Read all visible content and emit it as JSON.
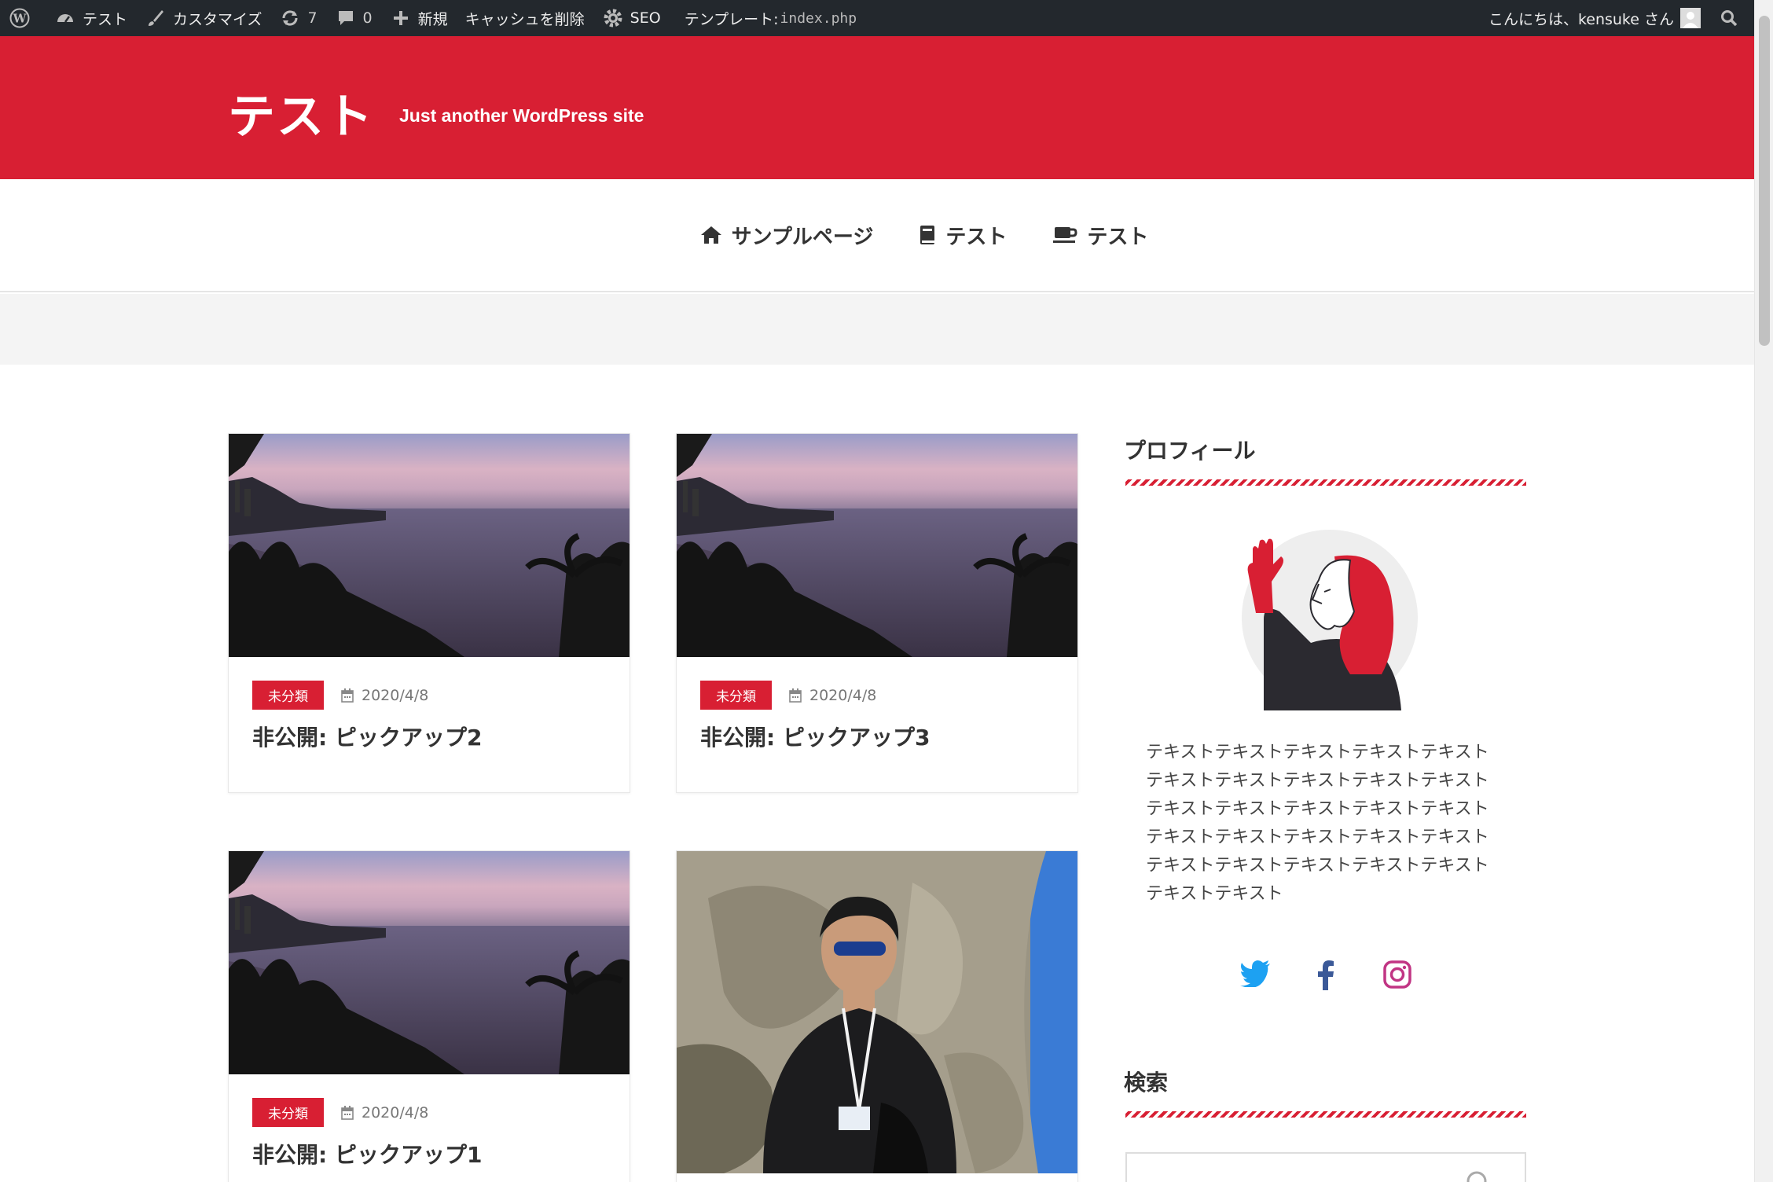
{
  "admin_bar": {
    "site_name": "テスト",
    "customize": "カスタマイズ",
    "updates_count": "7",
    "comments_count": "0",
    "new_label": "新規",
    "clear_cache": "キャッシュを削除",
    "seo": "SEO",
    "template_label": "テンプレート:",
    "template_file": "index.php",
    "greeting": "こんにちは、kensuke さん"
  },
  "header": {
    "title": "テスト",
    "description": "Just another WordPress site",
    "bg_color": "#d81f33"
  },
  "nav": {
    "items": [
      {
        "label": "サンプルページ",
        "icon": "home-icon"
      },
      {
        "label": "テスト",
        "icon": "book-icon"
      },
      {
        "label": "テスト",
        "icon": "coffee-icon"
      }
    ]
  },
  "posts": [
    {
      "category": "未分類",
      "date": "2020/4/8",
      "title": "非公開: ピックアップ2",
      "image": "beach-sunset"
    },
    {
      "category": "未分類",
      "date": "2020/4/8",
      "title": "非公開: ピックアップ3",
      "image": "beach-sunset"
    },
    {
      "category": "未分類",
      "date": "2020/4/8",
      "title": "非公開: ピックアップ1",
      "image": "beach-sunset"
    },
    {
      "image": "man-portrait"
    }
  ],
  "sidebar": {
    "profile_title": "プロフィール",
    "profile_text": "テキストテキストテキストテキストテキストテキストテキストテキストテキストテキストテキストテキストテキストテキストテキストテキストテキストテキストテキストテキストテキストテキストテキストテキストテキストテキストテキスト",
    "social": [
      "twitter-icon",
      "facebook-icon",
      "instagram-icon"
    ],
    "search_title": "検索"
  },
  "colors": {
    "accent": "#d81f33",
    "twitter": "#1da1f2",
    "facebook": "#3b5998",
    "instagram": "#c13584"
  }
}
